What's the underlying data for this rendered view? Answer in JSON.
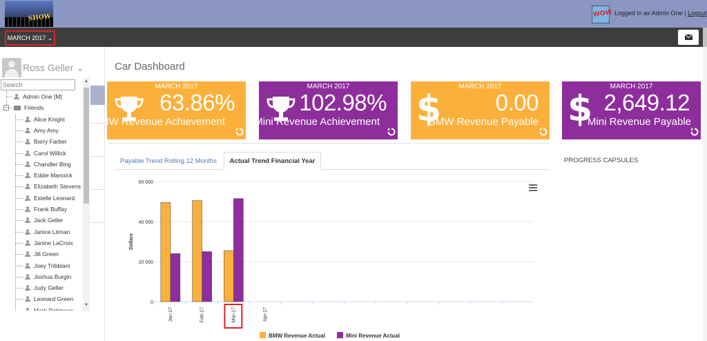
{
  "header": {
    "logo_text": "SHOW",
    "avatar_text": "WOW",
    "login_text": "Logged in as Admin One |",
    "logout_label": "Logout"
  },
  "toolbar": {
    "month_label": "MARCH 2017 ⌄"
  },
  "sidebar": {
    "user_name": "Ross Geller ⌄",
    "search_placeholder": "Search",
    "tree": [
      {
        "label": "Admin One [M]",
        "type": "person",
        "level": 1
      },
      {
        "label": "Friends",
        "type": "folder",
        "level": 1
      },
      {
        "label": "Alice Knight",
        "type": "person",
        "level": 2
      },
      {
        "label": "Amy Amy",
        "type": "person",
        "level": 2
      },
      {
        "label": "Barry Farber",
        "type": "person",
        "level": 2
      },
      {
        "label": "Carol Willick",
        "type": "person",
        "level": 2
      },
      {
        "label": "Chandler Bing",
        "type": "person",
        "level": 2
      },
      {
        "label": "Eddie Manoick",
        "type": "person",
        "level": 2
      },
      {
        "label": "Elizabeth Stevens",
        "type": "person",
        "level": 2
      },
      {
        "label": "Estelle Leonard",
        "type": "person",
        "level": 2
      },
      {
        "label": "Frank Buffay",
        "type": "person",
        "level": 2
      },
      {
        "label": "Jack Geller",
        "type": "person",
        "level": 2
      },
      {
        "label": "Janice Litman",
        "type": "person",
        "level": 2
      },
      {
        "label": "Janine LaCroix",
        "type": "person",
        "level": 2
      },
      {
        "label": "Jill Green",
        "type": "person",
        "level": 2
      },
      {
        "label": "Joey Tribbiani",
        "type": "person",
        "level": 2
      },
      {
        "label": "Joshua Burgin",
        "type": "person",
        "level": 2
      },
      {
        "label": "Judy Geller",
        "type": "person",
        "level": 2
      },
      {
        "label": "Leonard Green",
        "type": "person",
        "level": 2
      },
      {
        "label": "Mark Robinson",
        "type": "person",
        "level": 2
      }
    ]
  },
  "main": {
    "page_title": "Car Dashboard",
    "cards": [
      {
        "month": "MARCH 2017",
        "value": "63.86%",
        "label": "BMW Revenue Achievement",
        "color": "#fbb03b",
        "icon": "trophy-icon"
      },
      {
        "month": "MARCH 2017",
        "value": "102.98%",
        "label": "Mini Revenue Achievement",
        "color": "#8e2d9c",
        "icon": "trophy-icon"
      },
      {
        "month": "MARCH 2017",
        "value": "0.00",
        "label": "BMW Revenue Payable",
        "color": "#fbb03b",
        "icon": "dollar-icon"
      },
      {
        "month": "MARCH 2017",
        "value": "2,649.12",
        "label": "Mini Revenue Payable",
        "color": "#8e2d9c",
        "icon": "dollar-icon"
      }
    ],
    "tabs": [
      {
        "label": "Payable Trend Rolling 12 Months",
        "active": false
      },
      {
        "label": "Actual Trend Financial Year",
        "active": true
      }
    ],
    "progress_title": "PROGRESS CAPSULES"
  },
  "chart_data": {
    "type": "bar",
    "categories": [
      "Jan-17",
      "Feb-17",
      "Mar-17",
      "Apr-17",
      "",
      "",
      "",
      "",
      "",
      "",
      "",
      ""
    ],
    "series": [
      {
        "name": "BMW Revenue Actual",
        "color": "#fbb03b",
        "values": [
          49500,
          50500,
          25500,
          null,
          null,
          null,
          null,
          null,
          null,
          null,
          null,
          null
        ]
      },
      {
        "name": "Mini Revenue Actual",
        "color": "#8e2d9c",
        "values": [
          24000,
          25000,
          51500,
          null,
          null,
          null,
          null,
          null,
          null,
          null,
          null,
          null
        ]
      }
    ],
    "title": "",
    "xlabel": "",
    "ylabel": "Dollars",
    "ylim": [
      0,
      60000
    ],
    "yticks": [
      "0",
      "20 000",
      "40 000",
      "60 000"
    ],
    "ytick_values": [
      0,
      20000,
      40000,
      60000
    ],
    "grid": true,
    "legend": "bottom-center",
    "highlighted_category": "Mar-17"
  }
}
